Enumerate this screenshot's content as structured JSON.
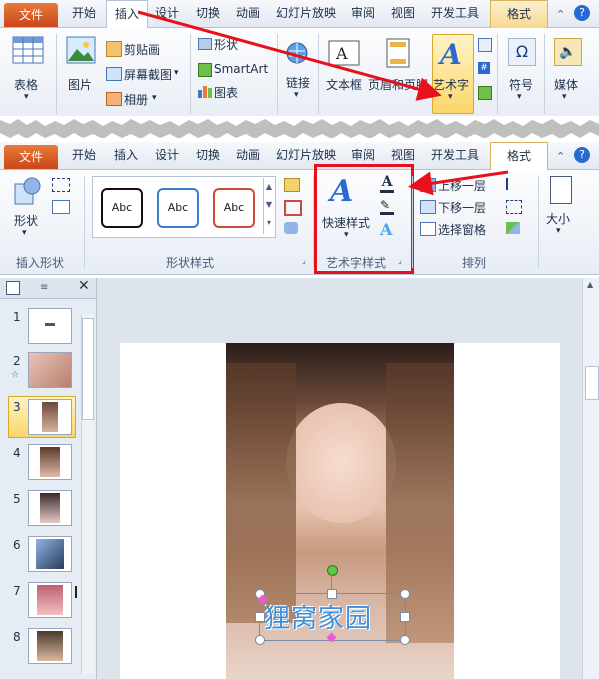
{
  "ribbon1": {
    "tabs": [
      "文件",
      "开始",
      "插入",
      "设计",
      "切换",
      "动画",
      "幻灯片放映",
      "审阅",
      "视图",
      "开发工具",
      "格式"
    ],
    "active_tab": "插入",
    "buttons": {
      "table": "表格",
      "picture": "图片",
      "clip_art": "剪贴画",
      "screenshot": "屏幕截图",
      "album": "相册",
      "shapes": "形状",
      "smartart": "SmartArt",
      "chart": "图表",
      "link": "链接",
      "textbox": "文本框",
      "header_footer": "页眉和页脚",
      "wordart": "艺术字",
      "symbol": "符号",
      "media": "媒体"
    }
  },
  "ribbon2": {
    "tabs": [
      "文件",
      "开始",
      "插入",
      "设计",
      "切换",
      "动画",
      "幻灯片放映",
      "审阅",
      "视图",
      "开发工具",
      "格式"
    ],
    "active_tab": "格式",
    "buttons": {
      "shape": "形状",
      "shape_style_samples": [
        "Abc",
        "Abc",
        "Abc"
      ],
      "quick_styles": "快速样式",
      "bring_forward": "上移一层",
      "send_backward": "下移一层",
      "selection_pane": "选择窗格",
      "size": "大小"
    },
    "groups": {
      "insert_shapes": "插入形状",
      "shape_styles": "形状样式",
      "wordart_styles": "艺术字样式",
      "arrange": "排列"
    }
  },
  "slides": {
    "numbers": [
      "1",
      "2",
      "3",
      "4",
      "5",
      "6",
      "7",
      "8"
    ],
    "selected": "3"
  },
  "canvas": {
    "wordart_text": "狸窝家园"
  },
  "colors": {
    "accent_file": "#d0551f",
    "highlight_red": "#e8101a",
    "ribbon_bg": "#eef2f8",
    "wordart_blue": "#3a8fe0"
  }
}
